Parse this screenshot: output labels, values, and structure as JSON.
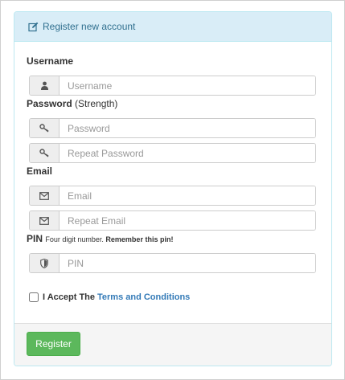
{
  "panel": {
    "heading": "Register new account"
  },
  "form": {
    "username_label": "Username",
    "username_placeholder": "Username",
    "password_label": "Password",
    "password_strength": "(Strength)",
    "password_placeholder": "Password",
    "repeat_password_placeholder": "Repeat Password",
    "email_label": "Email",
    "email_placeholder": "Email",
    "repeat_email_placeholder": "Repeat Email",
    "pin_label": "PIN",
    "pin_hint": "Four digit number.",
    "pin_hint_strong": "Remember this pin!",
    "pin_placeholder": "PIN",
    "accept_text": "I Accept The",
    "terms_link": "Terms and Conditions",
    "accept_checked": false
  },
  "footer": {
    "register_label": "Register"
  },
  "icons": {
    "heading": "edit-icon",
    "username": "user-icon",
    "password": "key-icon",
    "repeat_password": "key-icon",
    "email": "envelope-icon",
    "repeat_email": "envelope-icon",
    "pin": "shield-icon"
  },
  "colors": {
    "heading_bg": "#d9edf7",
    "heading_text": "#31708f",
    "panel_border": "#bce8f1",
    "register_bg": "#5cb85c",
    "link": "#337ab7"
  }
}
